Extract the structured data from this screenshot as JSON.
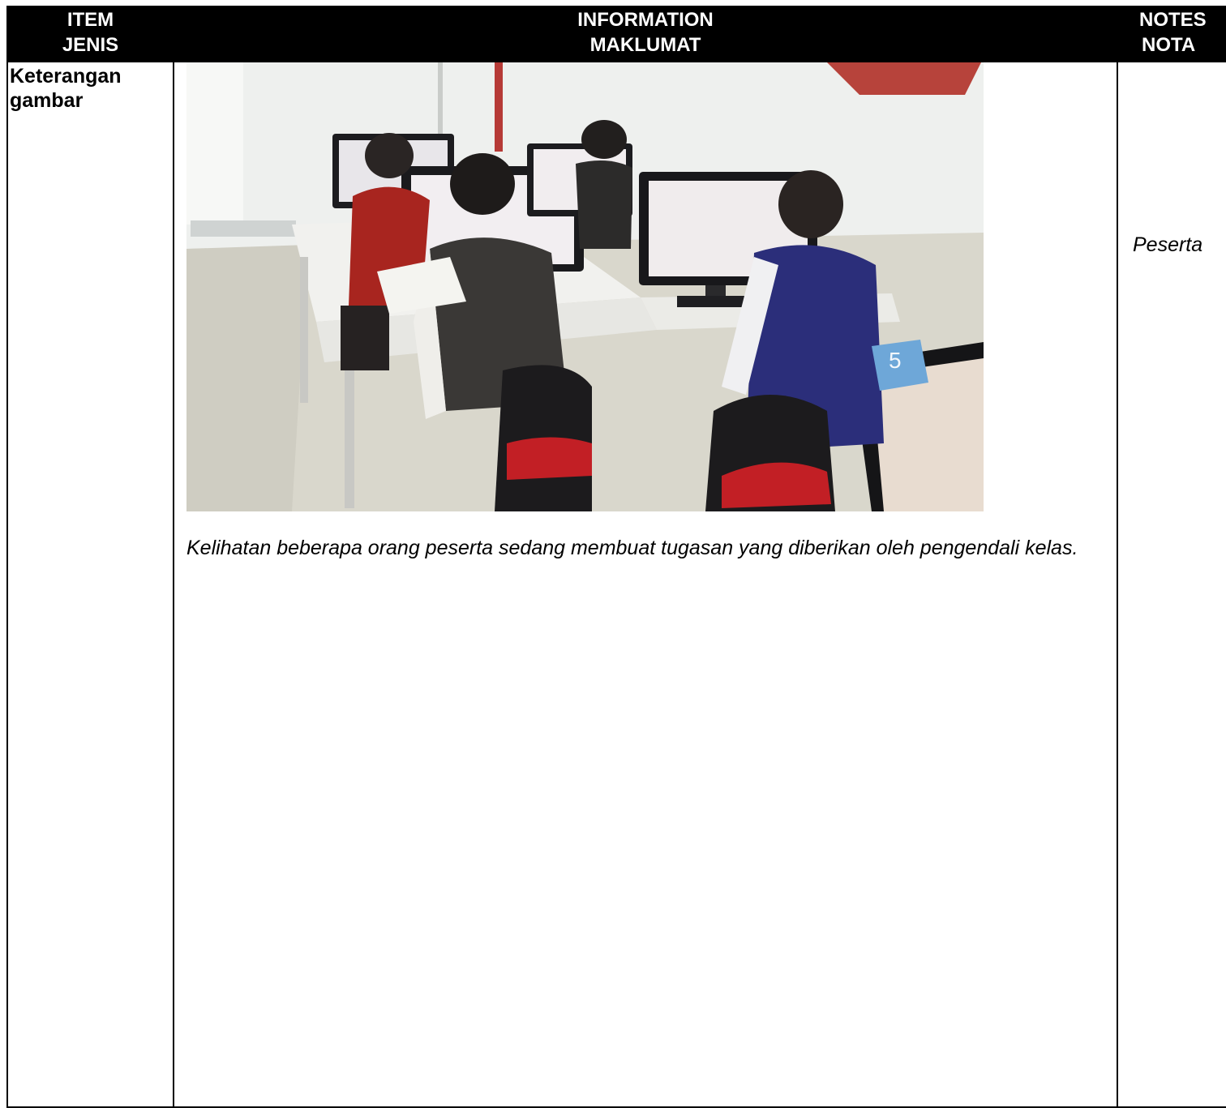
{
  "header": {
    "item_en": "ITEM",
    "item_ms": "JENIS",
    "info_en": "INFORMATION",
    "info_ms": "MAKLUMAT",
    "notes_en": "NOTES",
    "notes_ms": "NOTA"
  },
  "row": {
    "item_line1": "Keterangan",
    "item_line2": "gambar",
    "photo_label": "5",
    "caption": "Kelihatan beberapa orang peserta sedang membuat tugasan yang diberikan oleh pengendali kelas.",
    "notes": "Peserta"
  }
}
